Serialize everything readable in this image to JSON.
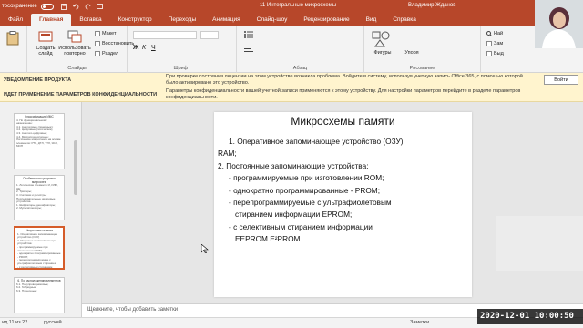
{
  "titlebar": {
    "autosave_label": "тосохранение",
    "doc_title": "11 Интегральные микросхемы",
    "user_name": "Владимир Жданов"
  },
  "tabs": [
    "Файл",
    "Главная",
    "Вставка",
    "Конструктор",
    "Переходы",
    "Анимация",
    "Слайд-шоу",
    "Рецензирование",
    "Вид",
    "Справка"
  ],
  "ribbon": {
    "create_slide": "Создать слайд",
    "reuse_slides": "Использовать повторно",
    "layout": "Макет",
    "reset": "Восстановить",
    "section": "Раздел",
    "slides_group": "Слайды",
    "font_group": "Шрифт",
    "paragraph_group": "Абзац",
    "shapes": "Фигуры",
    "arrange": "Упоря",
    "drawing_group": "Рисование",
    "right_items": [
      "Най",
      "Зам",
      "Выд"
    ]
  },
  "notices": [
    {
      "title": "УВЕДОМЛЕНИЕ ПРОДУКТА",
      "message": "При проверке состояния лицензии на этом устройстве возникла проблема. Войдите в систему, используя учетную запись Office 365, с помощью которой было активировано это устройство.",
      "button": "Войти"
    },
    {
      "title": "ИДЕТ ПРИМЕНЕНИЕ ПАРАМЕТРОВ КОНФИДЕНЦИАЛЬНОСТИ",
      "message": "Параметры конфиденциальности вашей учетной записи применяются к этому устройству. Для настройки параметров перейдите в разделе параметров конфиденциальности."
    }
  ],
  "thumbnails": [
    {
      "title": "Классификация ИМС",
      "lines": [
        "4. По функциональному назначению:",
        "4.1. Аналоговые (линейные);",
        "4.2. Цифровые (логические);",
        "4.3. Аналого-цифровые;",
        "4.4. Микропроцессорные;",
        "Логические микросхемы на основе",
        "элементов: РТЛ, ДТЛ, ТТЛ, ЭСЛ, МОП"
      ]
    },
    {
      "title": "Особенности цифровых микросхем",
      "lines": [
        "1. Логические элементы И, ИЛИ, НЕ;",
        "2. Триггеры;",
        "3. Счётчики и регистры;",
        "Последовательные цифровые устройства",
        "1. Шифраторы, дешифраторы;",
        "2. Мультиплексоры;"
      ]
    },
    {
      "title": "Микросхемы памяти",
      "lines": [
        "1. Оперативное запоминающее устройство (ОЗУ)",
        "2. Постоянные запоминающие устройства:",
        "- программируемые при изготовлении ROM;",
        "- однократно программированные - PROM;",
        "- перепрограммируемые с ультрафиолетовым стиранием",
        "- с селективным стиранием"
      ]
    },
    {
      "title": "6. По расположению элементов",
      "lines": [
        "6.1. Полупроводниковые;",
        "6.2. Гибридные;",
        "6.3. Плёночные;"
      ]
    }
  ],
  "slide": {
    "title": "Микросхемы памяти",
    "body": [
      "1.  Оперативное запоминающее устройство (ОЗУ)",
      "RAM;",
      "2. Постоянные запоминающие устройства:",
      "-  программируемые при изготовлении  ROM;",
      "-  однократно программированные  - PROM;",
      "-  перепрограммируемые с ультрафиолетовым",
      "стиранием информации  EPROM;",
      "-  с селективным стиранием информации",
      "EEPROM     E²PROM"
    ]
  },
  "notes_placeholder": "Щелкните, чтобы добавить заметки",
  "status": {
    "slide_info": "ид 11 из 22",
    "language": "русский",
    "notes_label": "Заметки"
  },
  "timestamp": "2020-12-01  10:00:50",
  "colors": {
    "brand": "#b7472a",
    "notice_bg": "#fff4ce",
    "selected_thumb": "#d55c2a"
  }
}
